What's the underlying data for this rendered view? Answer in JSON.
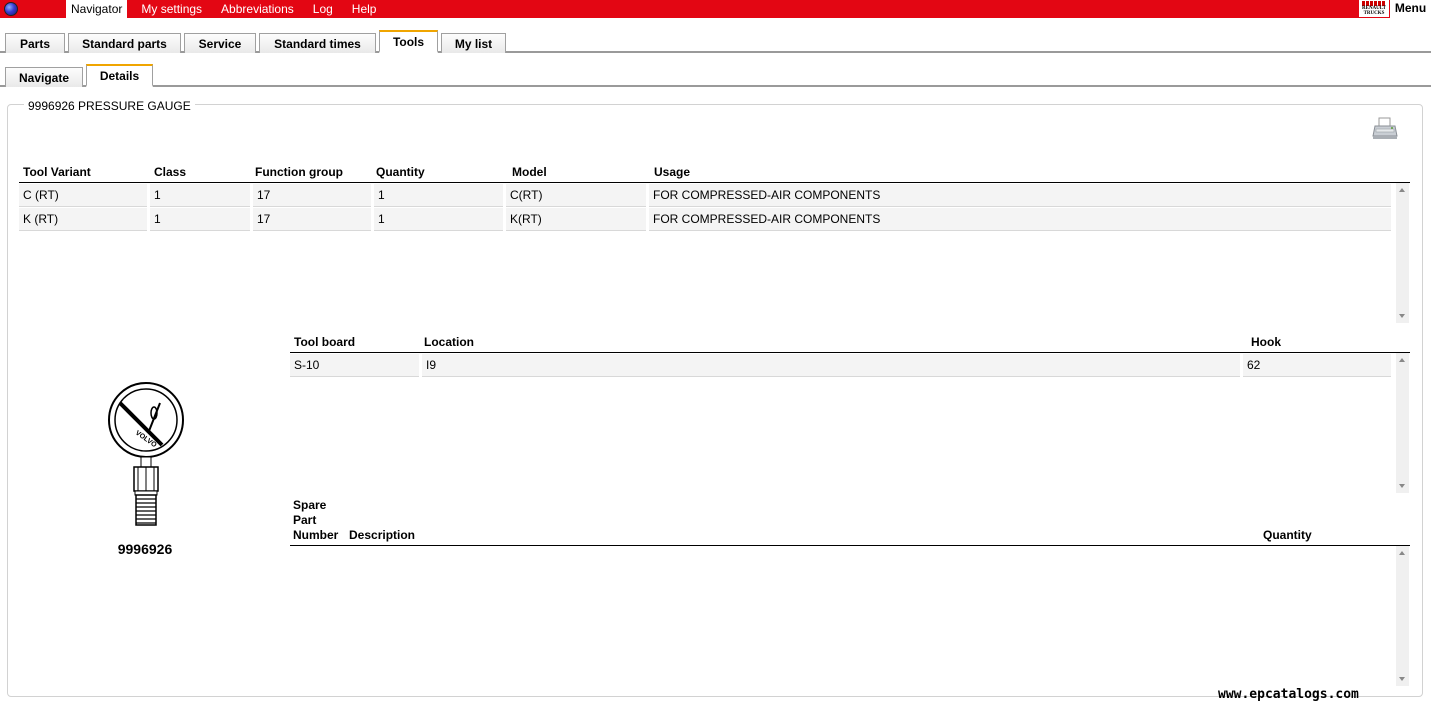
{
  "menubar": {
    "items": [
      "Navigator",
      "My settings",
      "Abbreviations",
      "Log",
      "Help"
    ],
    "active_index": 0,
    "logo_text": [
      "RENAULT",
      "TRUCKS"
    ],
    "menu_label": "Menu"
  },
  "main_tabs": [
    "Parts",
    "Standard parts",
    "Service",
    "Standard times",
    "Tools",
    "My list"
  ],
  "main_tabs_active": "Tools",
  "sub_tabs": [
    "Navigate",
    "Details"
  ],
  "sub_tabs_active": "Details",
  "group": {
    "title": "9996926 PRESSURE GAUGE"
  },
  "variants_table": {
    "headers": [
      "Tool Variant",
      "Class",
      "Function group",
      "Quantity",
      "Model",
      "Usage"
    ],
    "rows": [
      [
        "C (RT)",
        "1",
        "17",
        "1",
        "C(RT)",
        "FOR COMPRESSED-AIR COMPONENTS"
      ],
      [
        "K (RT)",
        "1",
        "17",
        "1",
        "K(RT)",
        "FOR COMPRESSED-AIR COMPONENTS"
      ]
    ]
  },
  "board_table": {
    "headers": [
      "Tool board",
      "Location",
      "Hook"
    ],
    "rows": [
      [
        "S-10",
        "I9",
        "62"
      ]
    ]
  },
  "spare_table": {
    "headers": [
      "Spare Part Number",
      "Description",
      "Quantity"
    ],
    "header_first_lines": [
      "Spare",
      "Part",
      "Number"
    ],
    "rows": []
  },
  "tool_image": {
    "caption": "9996926",
    "dial_text": "VOLVO"
  },
  "watermark": "www.epcatalogs.com",
  "colors": {
    "topbar": "#e30613",
    "active_tab_accent": "#f0a500"
  }
}
